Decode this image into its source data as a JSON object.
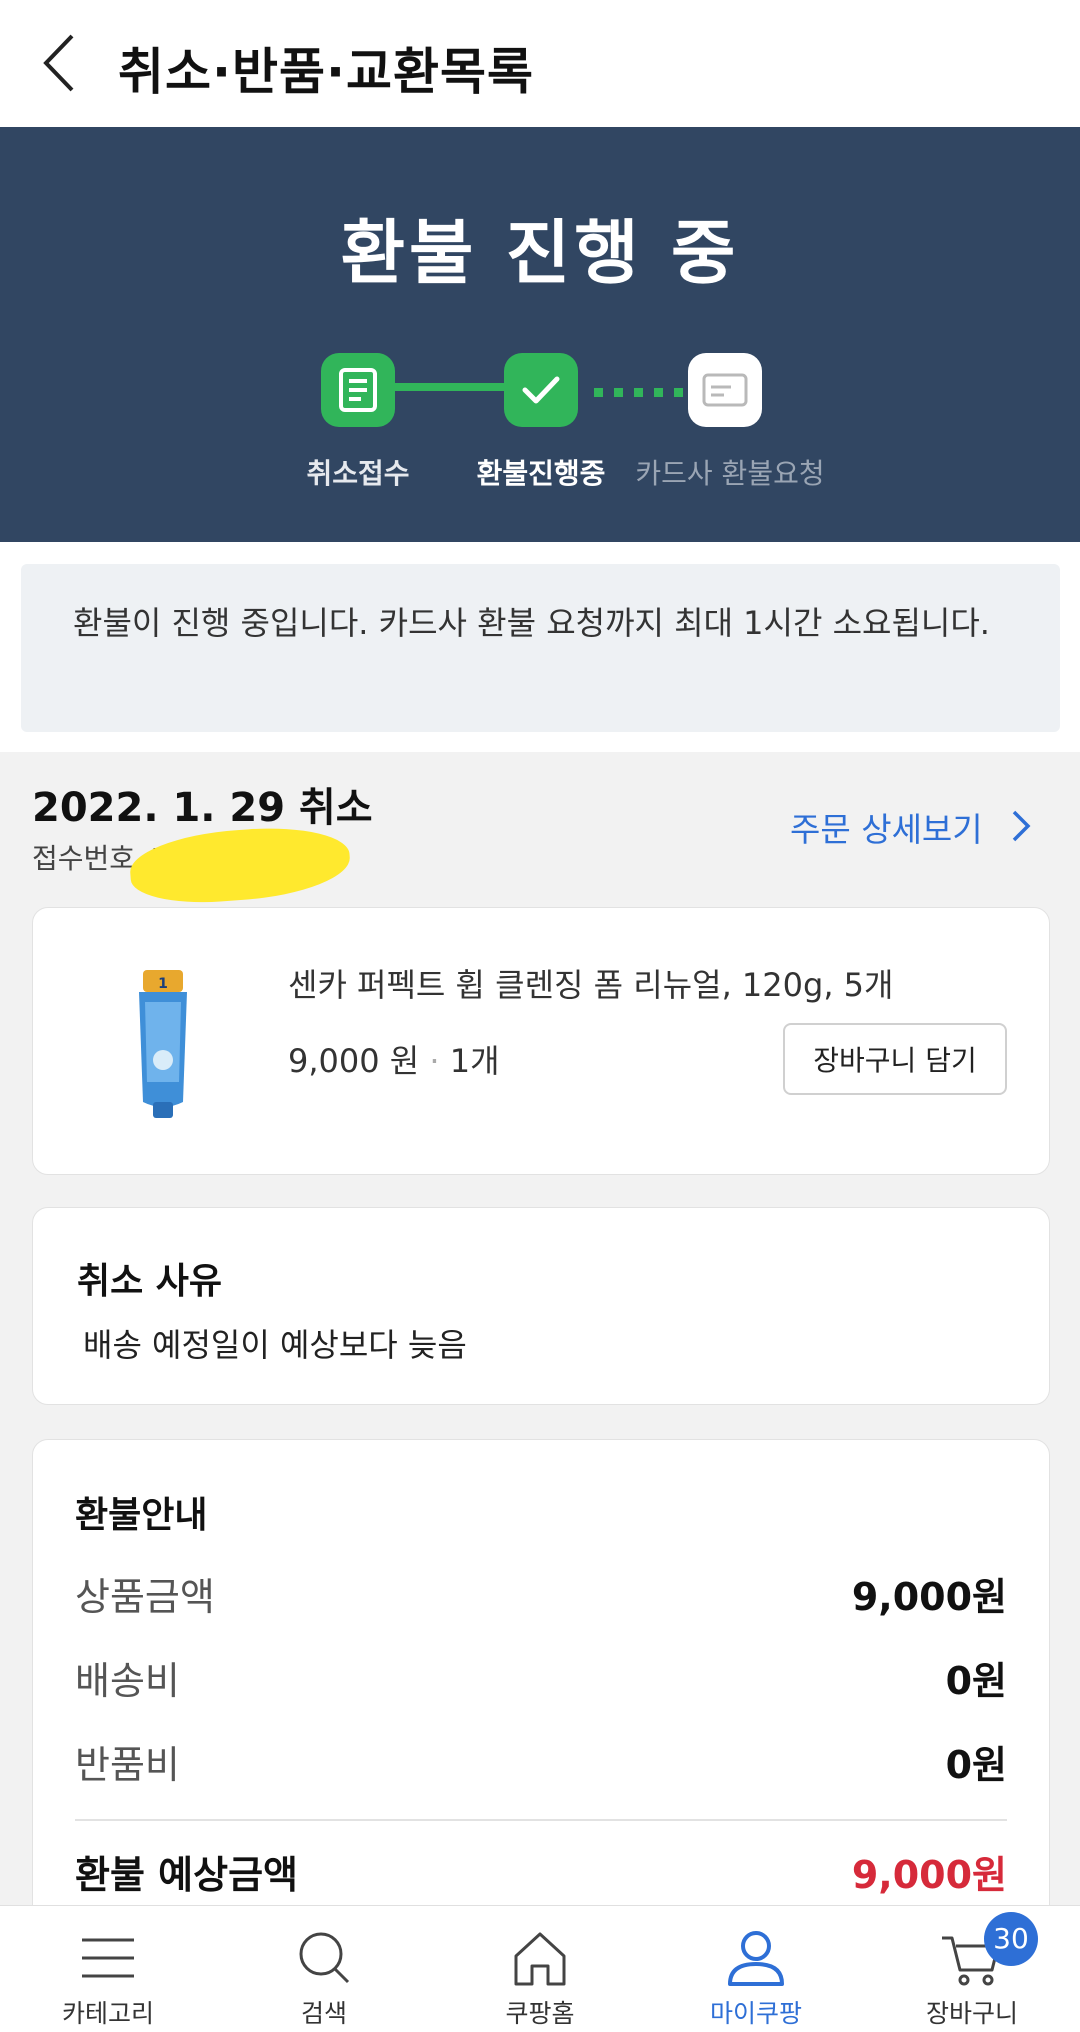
{
  "header": {
    "title": "취소·반품·교환목록"
  },
  "status": {
    "title": "환불 진행 중",
    "steps": [
      {
        "label": "취소접수",
        "state": "done"
      },
      {
        "label": "환불진행중",
        "state": "current"
      },
      {
        "label": "카드사 환불요청",
        "state": "pending"
      }
    ],
    "colors": {
      "banner": "#314662",
      "done": "#31b55a",
      "pending_label": "#9aa5b4"
    }
  },
  "notice": {
    "text": "환불이 진행 중입니다. 카드사 환불 요청까지 최대 1시간 소요됩니다."
  },
  "order": {
    "date_label": "2022. 1. 29 취소",
    "receipt_label": "접수번호 4",
    "detail_link": "주문 상세보기"
  },
  "product": {
    "name": "센카 퍼펙트 휩 클렌징 폼 리뉴얼, 120g, 5개",
    "price": "9,000 원",
    "separator": "·",
    "quantity": "1개",
    "cart_button": "장바구니 담기"
  },
  "reason": {
    "title": "취소 사유",
    "text": "배송 예정일이 예상보다 늦음"
  },
  "refund": {
    "title": "환불안내",
    "rows": [
      {
        "label": "상품금액",
        "value": "9,000원"
      },
      {
        "label": "배송비",
        "value": "0원"
      },
      {
        "label": "반품비",
        "value": "0원"
      }
    ],
    "total": {
      "label": "환불 예상금액",
      "value": "9,000원",
      "color": "#d62a3a"
    }
  },
  "bottom_nav": {
    "items": [
      {
        "label": "카테고리",
        "icon": "menu-icon"
      },
      {
        "label": "검색",
        "icon": "search-icon"
      },
      {
        "label": "쿠팡홈",
        "icon": "home-icon"
      },
      {
        "label": "마이쿠팡",
        "icon": "user-icon",
        "active": true
      },
      {
        "label": "장바구니",
        "icon": "cart-icon"
      }
    ],
    "cart_count": "30",
    "accent": "#2e6fd6"
  }
}
